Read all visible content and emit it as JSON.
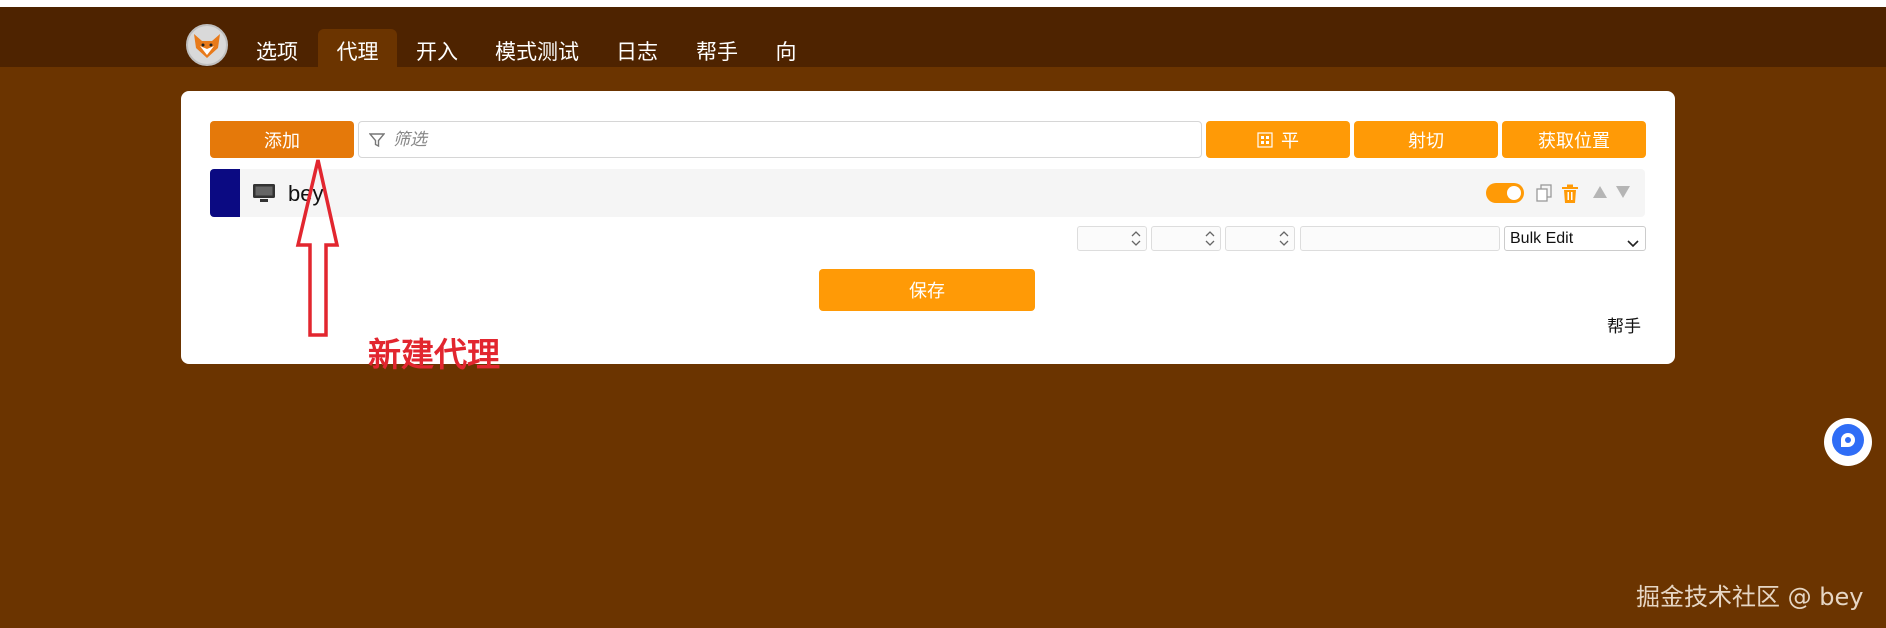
{
  "nav": {
    "items": [
      {
        "label": "选项"
      },
      {
        "label": "代理"
      },
      {
        "label": "开入"
      },
      {
        "label": "模式测试"
      },
      {
        "label": "日志"
      },
      {
        "label": "帮手"
      },
      {
        "label": "向"
      }
    ],
    "active": "代理"
  },
  "toolbar": {
    "add_label": "添加",
    "filter_placeholder": "筛选",
    "flat_label": "平",
    "cut_label": "射切",
    "get_location_label": "获取位置"
  },
  "proxy_list": [
    {
      "name": "bey",
      "color": "#0b0a82",
      "enabled": true
    }
  ],
  "bulk": {
    "select_value": "Bulk Edit"
  },
  "save_label": "保存",
  "help_label": "帮手",
  "annotation": {
    "text": "新建代理",
    "color": "#e2262f"
  },
  "watermark": "掘金技术社区 @ bey",
  "colors": {
    "nav_bg": "#4e2300",
    "page_bg": "#6b3400",
    "accent": "#ff9a06",
    "add_button": "#e5790a"
  }
}
